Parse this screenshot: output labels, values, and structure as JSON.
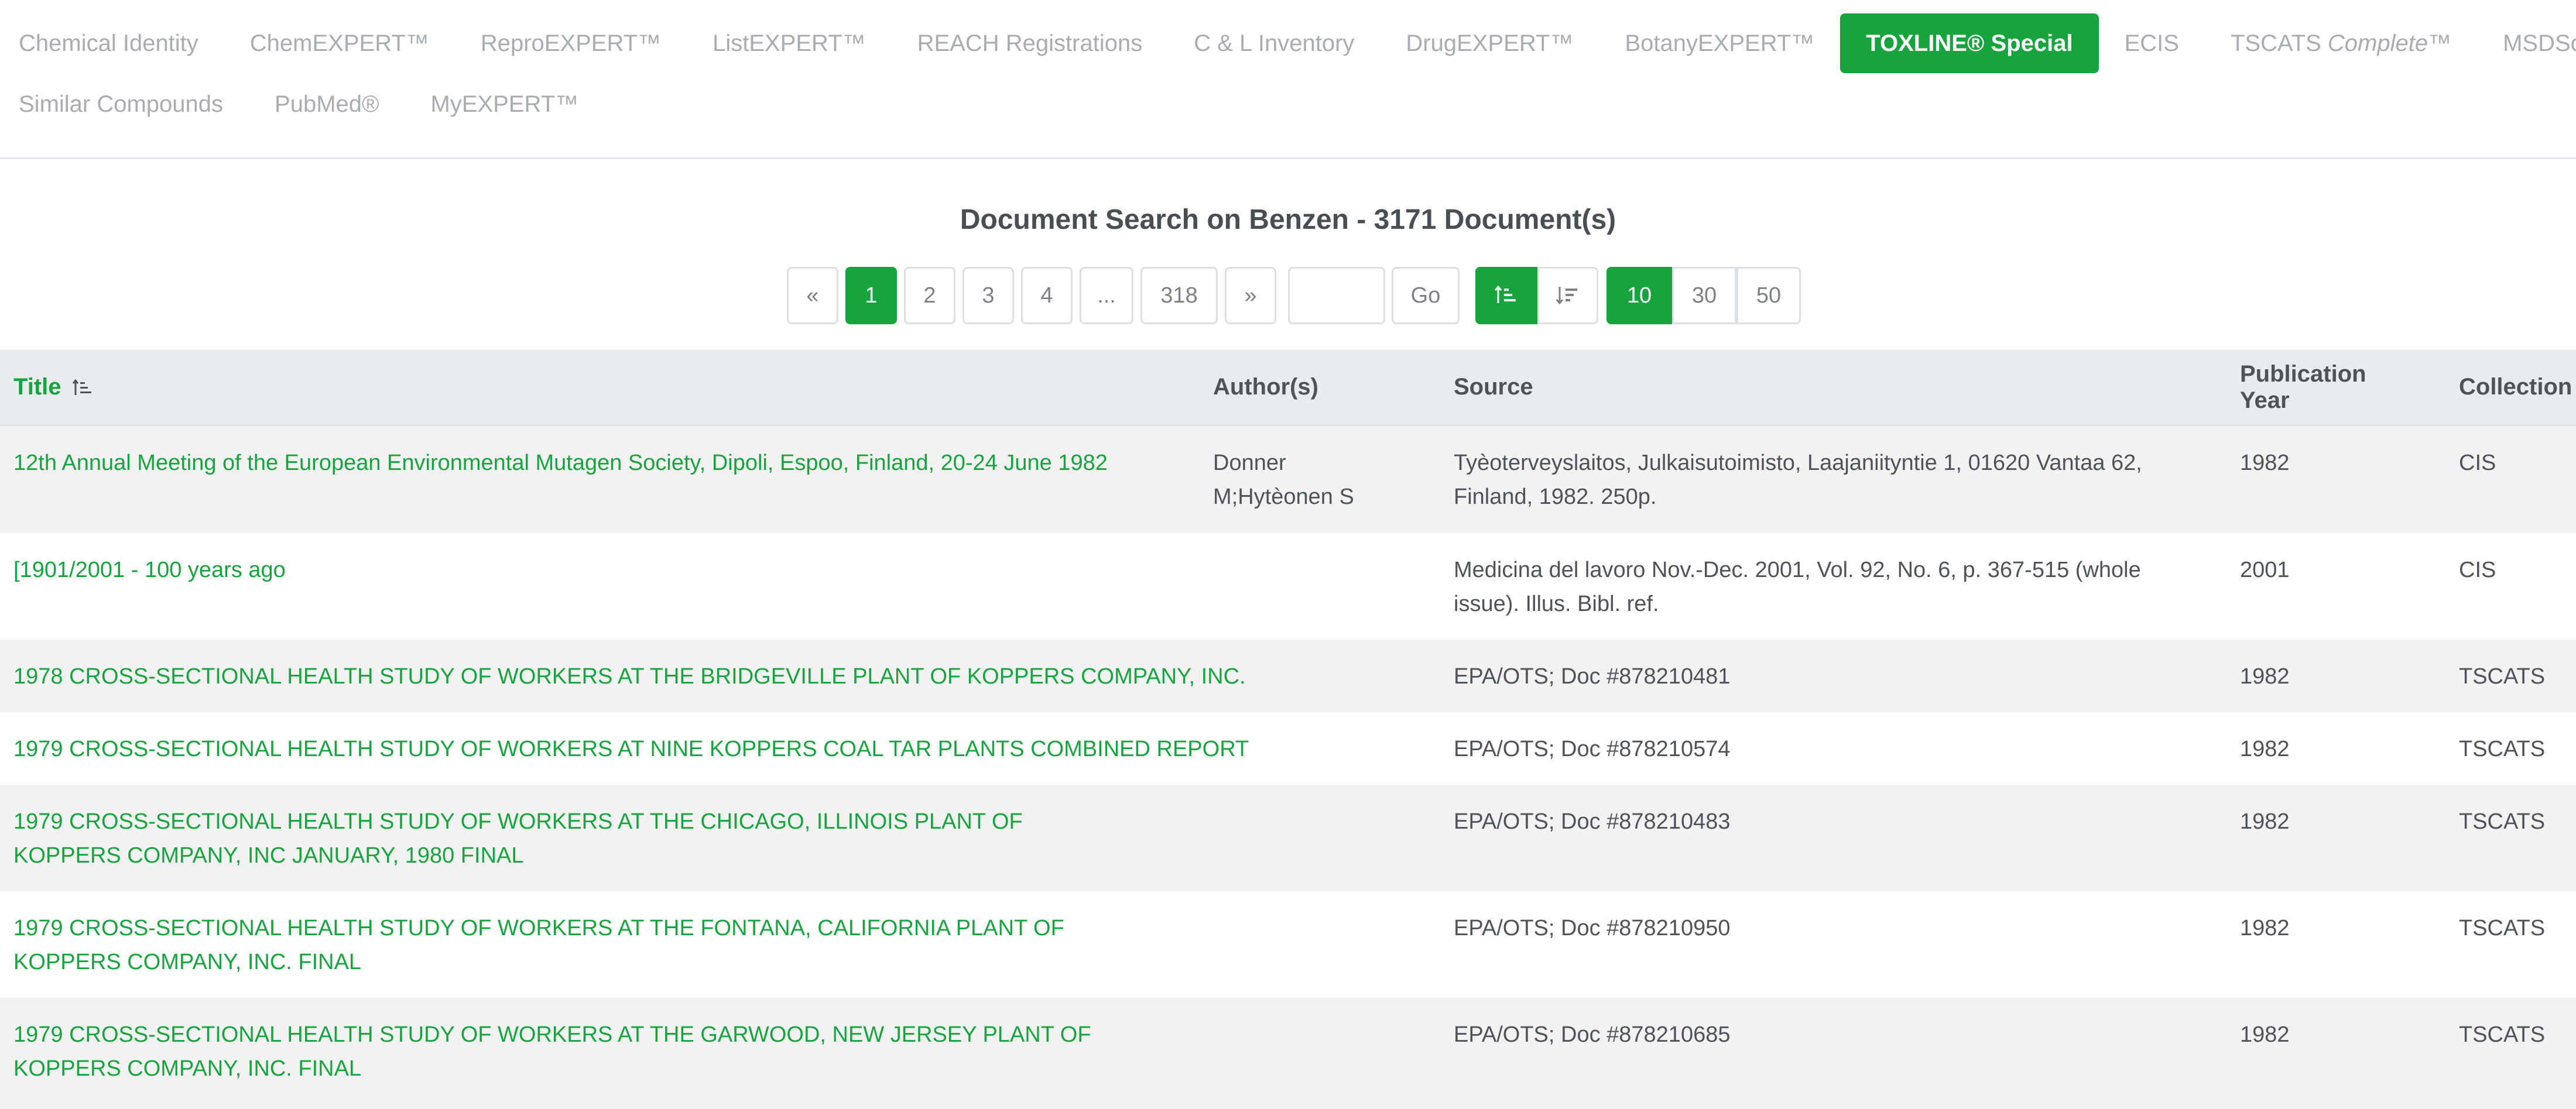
{
  "nav": {
    "row1": [
      {
        "label": "Chemical Identity"
      },
      {
        "label": "ChemEXPERT™"
      },
      {
        "label": "ReproEXPERT™"
      },
      {
        "label": "ListEXPERT™"
      },
      {
        "label": "REACH Registrations"
      },
      {
        "label": "C & L Inventory"
      },
      {
        "label": "DrugEXPERT™"
      },
      {
        "label": "BotanyEXPERT™"
      },
      {
        "label": "TOXLINE® Special"
      },
      {
        "label": "ECIS"
      },
      {
        "label_a": "TSCATS ",
        "label_b": "Complete",
        "label_c": "™"
      },
      {
        "label": "MSDSonline®"
      }
    ],
    "row2": [
      {
        "label": "Similar Compounds"
      },
      {
        "label": "PubMed®"
      },
      {
        "label": "MyEXPERT™"
      }
    ],
    "active": "TOXLINE® Special"
  },
  "search_title": "Document Search on Benzen - 3171 Document(s)",
  "pagination": {
    "prev": "«",
    "pages": [
      "1",
      "2",
      "3",
      "4",
      "...",
      "318"
    ],
    "current": "1",
    "next": "»",
    "go_label": "Go",
    "page_input_value": ""
  },
  "sort": {
    "asc_icon": "sort-ascending-icon",
    "desc_icon": "sort-descending-icon",
    "active": "asc"
  },
  "page_size": {
    "options": [
      "10",
      "30",
      "50"
    ],
    "selected": "10"
  },
  "table": {
    "headers": {
      "title": "Title",
      "authors": "Author(s)",
      "source": "Source",
      "year": "Publication Year",
      "collection": "Collection"
    },
    "rows": [
      {
        "title": "12th Annual Meeting of the European Environmental Mutagen Society, Dipoli, Espoo, Finland, 20-24 June 1982",
        "authors": "Donner M;Hytèonen S",
        "source": "Tyèoterveyslaitos, Julkaisutoimisto, Laajaniityntie 1, 01620 Vantaa 62, Finland, 1982. 250p.",
        "year": "1982",
        "collection": "CIS"
      },
      {
        "title": "[1901/2001 - 100 years ago",
        "authors": "",
        "source": "Medicina del lavoro Nov.-Dec. 2001, Vol. 92, No. 6, p. 367-515 (whole issue). Illus. Bibl. ref.",
        "year": "2001",
        "collection": "CIS"
      },
      {
        "title": "1978 CROSS-SECTIONAL HEALTH STUDY OF WORKERS AT THE BRIDGEVILLE PLANT OF KOPPERS COMPANY, INC.",
        "authors": "",
        "source": "EPA/OTS; Doc #878210481",
        "year": "1982",
        "collection": "TSCATS"
      },
      {
        "title": "1979 CROSS-SECTIONAL HEALTH STUDY OF WORKERS AT NINE KOPPERS COAL TAR PLANTS COMBINED REPORT",
        "authors": "",
        "source": "EPA/OTS; Doc #878210574",
        "year": "1982",
        "collection": "TSCATS"
      },
      {
        "title": "1979 CROSS-SECTIONAL HEALTH STUDY OF WORKERS AT THE CHICAGO, ILLINOIS PLANT OF KOPPERS COMPANY, INC JANUARY, 1980 FINAL",
        "authors": "",
        "source": "EPA/OTS; Doc #878210483",
        "year": "1982",
        "collection": "TSCATS"
      },
      {
        "title": "1979 CROSS-SECTIONAL HEALTH STUDY OF WORKERS AT THE FONTANA, CALIFORNIA PLANT OF KOPPERS COMPANY, INC. FINAL",
        "authors": "",
        "source": "EPA/OTS; Doc #878210950",
        "year": "1982",
        "collection": "TSCATS"
      },
      {
        "title": "1979 CROSS-SECTIONAL HEALTH STUDY OF WORKERS AT THE GARWOOD, NEW JERSEY PLANT OF KOPPERS COMPANY, INC. FINAL",
        "authors": "",
        "source": "EPA/OTS; Doc #878210685",
        "year": "1982",
        "collection": "TSCATS"
      }
    ]
  },
  "colors": {
    "accent": "#17a43e",
    "nav_inactive": "#a9acb0",
    "header_bg": "#e9ecef",
    "stripe": "#f2f2f2"
  }
}
